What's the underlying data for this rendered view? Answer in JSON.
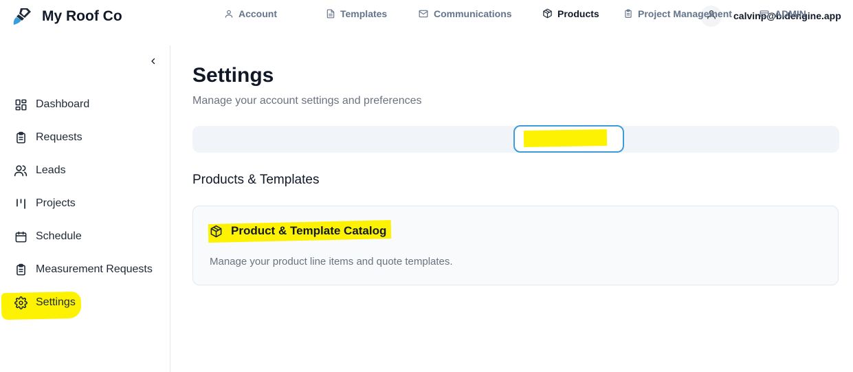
{
  "header": {
    "brand": "My Roof Co",
    "logo_icon": "paint-brush-icon",
    "user_icon": "user-icon",
    "user_email": "calvinp@bidengine.app"
  },
  "sidebar": {
    "collapse_icon": "chevron-left-icon",
    "items": [
      {
        "label": "Dashboard",
        "icon": "layout-dashboard-icon"
      },
      {
        "label": "Requests",
        "icon": "clipboard-icon"
      },
      {
        "label": "Leads",
        "icon": "users-icon"
      },
      {
        "label": "Projects",
        "icon": "kanban-icon"
      },
      {
        "label": "Schedule",
        "icon": "calendar-icon"
      },
      {
        "label": "Measurement Requests",
        "icon": "clipboard-list-icon"
      },
      {
        "label": "Settings",
        "icon": "gear-icon",
        "active": true
      }
    ]
  },
  "main": {
    "title": "Settings",
    "subtitle": "Manage your account settings and preferences",
    "tabs": [
      {
        "label": "Account",
        "icon": "user-icon"
      },
      {
        "label": "Templates",
        "icon": "file-text-icon"
      },
      {
        "label": "Communications",
        "icon": "mail-icon"
      },
      {
        "label": "Products",
        "icon": "package-icon",
        "active": true
      },
      {
        "label": "Project Management",
        "icon": "clipboard-icon"
      },
      {
        "label": "ADMIN",
        "icon": "credit-card-icon"
      }
    ],
    "section_title": "Products & Templates",
    "card": {
      "title": "Product & Template Catalog",
      "icon": "package-icon",
      "description": "Manage your product line items and quote templates."
    }
  },
  "colors": {
    "highlight": "#fdf201",
    "active_tab_border": "#3b9bdb",
    "tab_bar_bg": "#f1f5f9"
  }
}
